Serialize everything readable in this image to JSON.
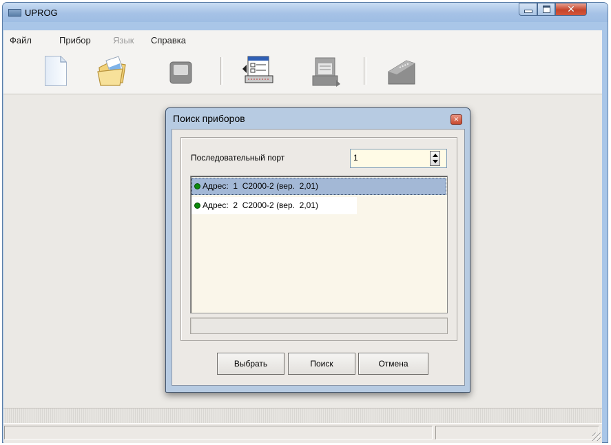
{
  "window": {
    "title": "UPROG",
    "min_icon": "minimize-icon",
    "max_icon": "maximize-icon",
    "close_icon": "close-icon",
    "close_glyph": "✕"
  },
  "menu": {
    "file": "Файл",
    "device": "Прибор",
    "language": "Язык",
    "help": "Справка"
  },
  "toolbar": {
    "icons": [
      "new-file-icon",
      "open-folder-icon",
      "save-icon",
      "read-config-icon",
      "write-config-icon",
      "firmware-icon"
    ]
  },
  "dialog": {
    "title": "Поиск приборов",
    "close_glyph": "×",
    "port_label": "Последовательный порт",
    "port_value": "1",
    "devices": [
      {
        "text": "Адрес:  1  С2000-2 (вер.  2,01)",
        "status_color": "#0d8a0d",
        "selected": true
      },
      {
        "text": "Адрес:  2  С2000-2 (вер.  2,01)",
        "status_color": "#0d8a0d",
        "selected": false
      }
    ],
    "buttons": {
      "select": "Выбрать",
      "search": "Поиск",
      "cancel": "Отмена"
    }
  }
}
